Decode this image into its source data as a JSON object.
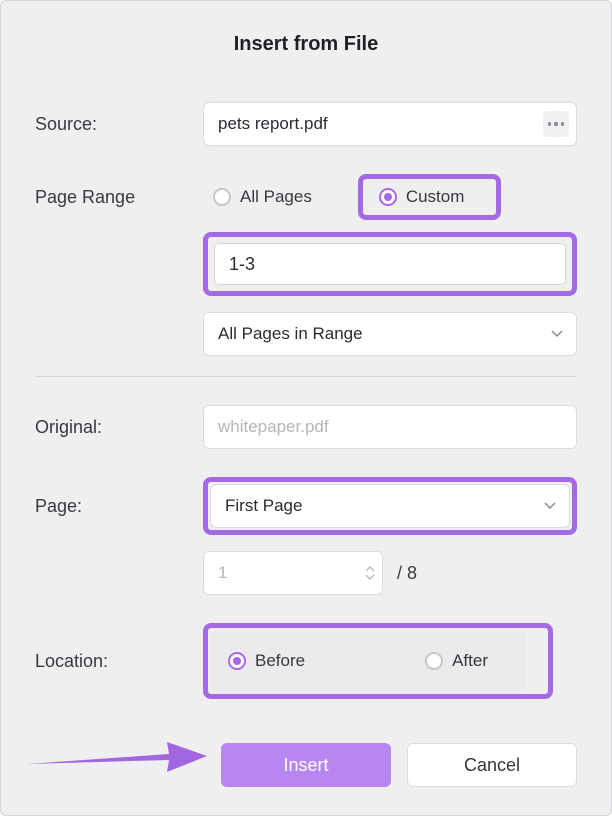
{
  "title": "Insert from File",
  "labels": {
    "source": "Source:",
    "pageRange": "Page Range",
    "original": "Original:",
    "page": "Page:",
    "location": "Location:"
  },
  "source": {
    "value": "pets report.pdf"
  },
  "pageRange": {
    "allPagesLabel": "All Pages",
    "customLabel": "Custom",
    "rangeValue": "1-3",
    "subsetSelected": "All Pages in Range"
  },
  "original": {
    "value": "whitepaper.pdf"
  },
  "page": {
    "selected": "First Page",
    "num": "1",
    "total": "/ 8"
  },
  "location": {
    "beforeLabel": "Before",
    "afterLabel": "After"
  },
  "buttons": {
    "insert": "Insert",
    "cancel": "Cancel"
  }
}
